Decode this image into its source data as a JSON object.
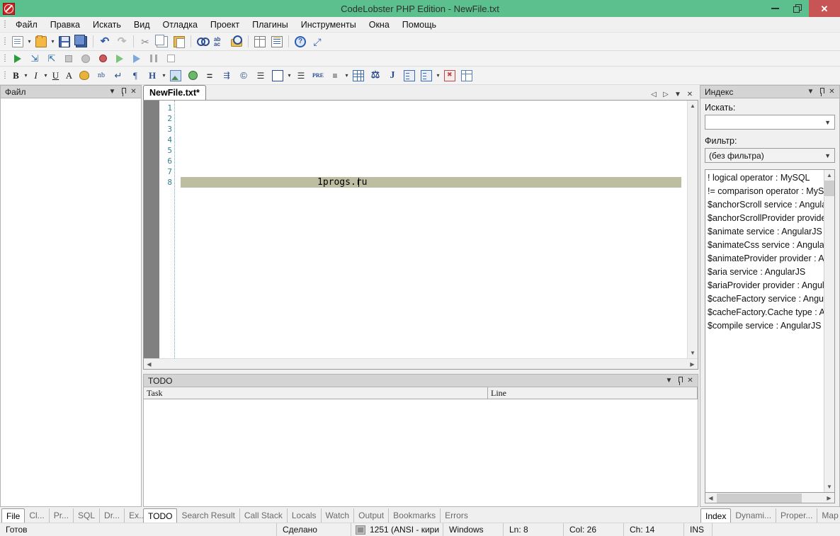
{
  "window": {
    "title": "CodeLobster PHP Edition - NewFile.txt",
    "app_icon": "codelobster-icon",
    "minimize_label": "minimize-icon",
    "maximize_label": "restore-icon",
    "close_label": "✕",
    "titlebar_color": "#5cbf8e",
    "close_color": "#c75555"
  },
  "menubar": {
    "items": [
      {
        "label": "Файл",
        "accel": "Ф"
      },
      {
        "label": "Правка",
        "accel": "П"
      },
      {
        "label": "Искать",
        "accel": "И"
      },
      {
        "label": "Вид",
        "accel": "В"
      },
      {
        "label": "Отладка",
        "accel": "О"
      },
      {
        "label": "Проект",
        "accel": "П"
      },
      {
        "label": "Плагины",
        "accel": ""
      },
      {
        "label": "Инструменты",
        "accel": "Ин"
      },
      {
        "label": "Окна",
        "accel": "О"
      },
      {
        "label": "Помощь",
        "accel": "П"
      }
    ]
  },
  "toolbar_main": {
    "buttons": [
      "new-file-icon",
      "new-file-dropdown",
      "open-file-icon",
      "open-file-dropdown",
      "save-icon",
      "save-all-icon",
      "undo-icon",
      "redo-icon",
      "cut-icon",
      "copy-icon",
      "paste-icon",
      "find-icon",
      "replace-icon",
      "find-in-files-icon",
      "toggle-panel-icon",
      "line-numbers-icon",
      "help-icon",
      "fullscreen-icon"
    ]
  },
  "toolbar_debug": {
    "buttons": [
      "run-icon",
      "step-into-icon",
      "step-out-icon",
      "stop-icon",
      "record-icon",
      "breakpoint-icon",
      "run-to-cursor-icon",
      "continue-icon",
      "pause-icon",
      "stop-square-icon"
    ]
  },
  "toolbar_format": {
    "buttons": [
      "bold-icon",
      "bold-dropdown",
      "italic-icon",
      "italic-dropdown",
      "underline-icon",
      "font-icon",
      "color-palette-icon",
      "nbsp-icon",
      "line-break-icon",
      "paragraph-icon",
      "heading-icon",
      "heading-dropdown",
      "image-icon",
      "link-icon",
      "horizontal-rule-icon",
      "anchor-icon",
      "at-icon",
      "align-left-icon",
      "div-icon",
      "div-dropdown",
      "align-justify-icon",
      "pre-icon",
      "list-icon",
      "list-dropdown",
      "table-icon",
      "script-icon",
      "java-icon",
      "form-icon",
      "form-element-icon",
      "form-element-dropdown",
      "no-image-icon",
      "frames-icon"
    ]
  },
  "left_panel": {
    "title": "Файл",
    "menu_icon": "chevron-down-icon",
    "pin_icon": "pin-icon",
    "close_icon": "close-icon",
    "tabs": [
      {
        "label": "File",
        "active": true
      },
      {
        "label": "Cl...",
        "active": false
      },
      {
        "label": "Pr...",
        "active": false
      },
      {
        "label": "SQL",
        "active": false
      },
      {
        "label": "Dr...",
        "active": false
      },
      {
        "label": "Ex...",
        "active": false
      }
    ]
  },
  "editor": {
    "tab_label": "NewFile.txt*",
    "nav_prev_icon": "nav-prev-icon",
    "nav_next_icon": "nav-next-icon",
    "nav_list_icon": "tab-list-icon",
    "nav_close_icon": "close-tab-icon",
    "line_numbers": [
      "1",
      "2",
      "3",
      "4",
      "5",
      "6",
      "7",
      "8"
    ],
    "current_line": 8,
    "current_line_text": "1progs.ru",
    "highlight_color": "#bdbda1",
    "scroll_up_icon": "▲",
    "scroll_down_icon": "▼",
    "scroll_left_icon": "◀",
    "scroll_right_icon": "▶"
  },
  "todo_panel": {
    "title": "TODO",
    "menu_icon": "chevron-down-icon",
    "pin_icon": "pin-icon",
    "close_icon": "close-icon",
    "columns": [
      "Task",
      "Line"
    ],
    "rows": []
  },
  "bottom_tabs": [
    {
      "label": "TODO",
      "active": true
    },
    {
      "label": "Search Result",
      "active": false
    },
    {
      "label": "Call Stack",
      "active": false
    },
    {
      "label": "Locals",
      "active": false
    },
    {
      "label": "Watch",
      "active": false
    },
    {
      "label": "Output",
      "active": false
    },
    {
      "label": "Bookmarks",
      "active": false
    },
    {
      "label": "Errors",
      "active": false
    }
  ],
  "index_panel": {
    "title": "Индекс",
    "menu_icon": "chevron-down-icon",
    "pin_icon": "pin-icon",
    "close_icon": "close-icon",
    "search_label": "Искать:",
    "search_value": "",
    "search_placeholder": "",
    "filter_label": "Фильтр:",
    "filter_value": "(без фильтра)",
    "items": [
      "! logical operator : MySQL",
      "!= comparison operator : MyS",
      "$anchorScroll service : Angula",
      "$anchorScrollProvider provide",
      "$animate service : AngularJS",
      "$animateCss service : Angular",
      "$animateProvider provider : A",
      "$aria service : AngularJS",
      "$ariaProvider provider : Angul",
      "$cacheFactory service : Angul",
      "$cacheFactory.Cache type : A",
      "$compile service : AngularJS"
    ],
    "tabs": [
      {
        "label": "Index",
        "active": true
      },
      {
        "label": "Dynami...",
        "active": false
      },
      {
        "label": "Proper...",
        "active": false
      },
      {
        "label": "Map",
        "active": false
      }
    ]
  },
  "statusbar": {
    "ready": "Готов",
    "done": "Сделано",
    "encoding_icon": "encoding-icon",
    "encoding": "1251 (ANSI - кири",
    "line_endings": "Windows",
    "line": "Ln: 8",
    "col": "Col: 26",
    "ch": "Ch: 14",
    "insert_mode": "INS"
  }
}
